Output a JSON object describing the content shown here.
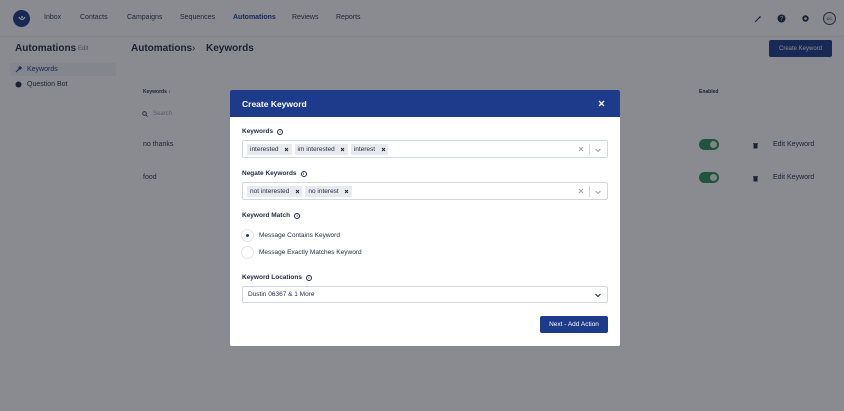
{
  "nav": {
    "items": [
      "Inbox",
      "Contacts",
      "Campaigns",
      "Sequences",
      "Automations",
      "Reviews",
      "Reports"
    ],
    "active": "Automations",
    "avatar_initials": "DC"
  },
  "sidebar": {
    "title": "Automations",
    "edit_label": "Edit",
    "items": [
      {
        "label": "Keywords",
        "icon": "key-icon",
        "active": true
      },
      {
        "label": "Question Bot",
        "icon": "bot-icon",
        "active": false
      }
    ]
  },
  "header": {
    "crumb_root": "Automations",
    "separator": "›",
    "crumb_current": "Keywords",
    "create_button": "Create Keyword"
  },
  "table": {
    "columns": {
      "keywords": "Keywords ↕",
      "enabled": "Enabled"
    },
    "search_placeholder": "Search",
    "rows": [
      {
        "keyword": "no thanks",
        "enabled": true,
        "edit": "Edit Keyword"
      },
      {
        "keyword": "food",
        "enabled": true,
        "edit": "Edit Keyword"
      }
    ]
  },
  "modal": {
    "title": "Create Keyword",
    "keywords_label": "Keywords",
    "keywords": [
      "interested",
      "im interested",
      "interest"
    ],
    "negate_label": "Negate Keywords",
    "negate_keywords": [
      "not interested",
      "no interest"
    ],
    "match_label": "Keyword Match",
    "match_options": [
      {
        "label": "Message Contains Keyword",
        "selected": true
      },
      {
        "label": "Message Exactly Matches Keyword",
        "selected": false
      }
    ],
    "locations_label": "Keyword Locations",
    "locations_value": "Dustin 06367 & 1 More",
    "next_button": "Next - Add Action"
  },
  "colors": {
    "brand": "#1e3a8a",
    "toggle_on": "#2f8f5a"
  }
}
